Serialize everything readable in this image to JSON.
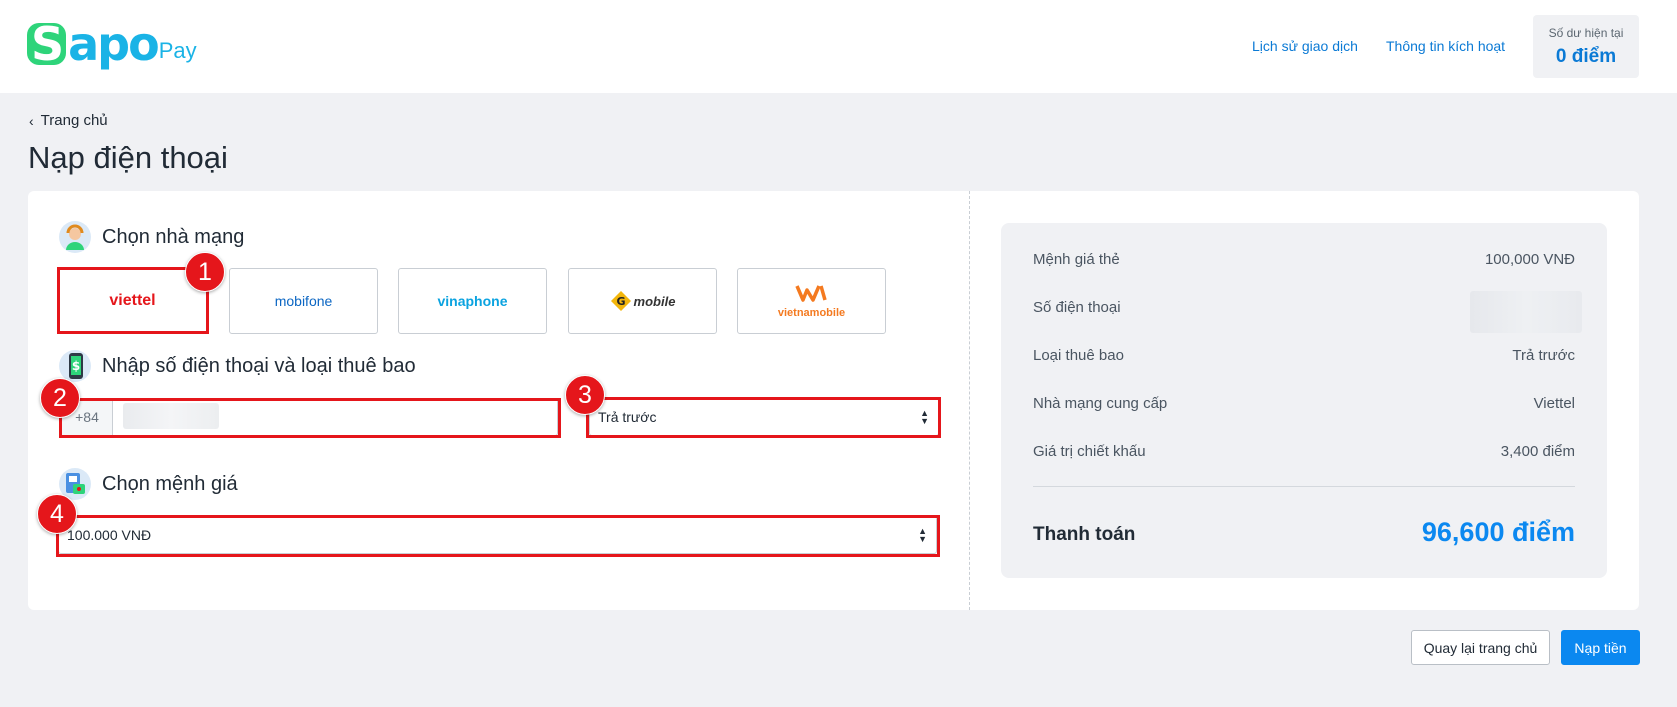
{
  "brand": {
    "logo_main": "Sapo",
    "logo_sub": "Pay"
  },
  "header": {
    "nav": [
      "Lịch sử giao dịch",
      "Thông tin kích hoạt"
    ],
    "balance_label": "Số dư hiện tại",
    "balance_value": "0 điểm"
  },
  "breadcrumb": {
    "label": "Trang chủ"
  },
  "page_title": "Nạp điện thoại",
  "form": {
    "carrier_section_title": "Chọn nhà mạng",
    "carriers": [
      {
        "label": "viettel",
        "color": "#e5161b",
        "selected": true
      },
      {
        "label": "mobifone",
        "color": "#0b66c3",
        "selected": false
      },
      {
        "label": "vinaphone",
        "color": "#0ba3e0",
        "selected": false
      },
      {
        "label": "mobile",
        "color": "#333333",
        "selected": false
      },
      {
        "label": "vietnamobile",
        "color": "#f47a20",
        "selected": false
      }
    ],
    "phone_section_title": "Nhập số điện thoại và loại thuê bao",
    "phone_prefix": "+84",
    "phone_value": "",
    "subscriber_type": "Trả trước",
    "denomination_section_title": "Chọn mệnh giá",
    "denomination": "100.000 VNĐ"
  },
  "annotations": [
    "1",
    "2",
    "3",
    "4"
  ],
  "summary": {
    "rows": [
      {
        "label": "Mệnh giá thẻ",
        "value": "100,000 VNĐ"
      },
      {
        "label": "Số điện thoại",
        "value": ""
      },
      {
        "label": "Loại thuê bao",
        "value": "Trả trước"
      },
      {
        "label": "Nhà mạng cung cấp",
        "value": "Viettel"
      },
      {
        "label": "Giá trị chiết khấu",
        "value": "3,400 điểm"
      }
    ],
    "total_label": "Thanh toán",
    "total_value": "96,600 điểm"
  },
  "actions": {
    "back_label": "Quay lại trang chủ",
    "submit_label": "Nạp tiền"
  },
  "colors": {
    "primary": "#0b88f0",
    "annotation": "#e5161b",
    "background": "#f0f1f4"
  }
}
